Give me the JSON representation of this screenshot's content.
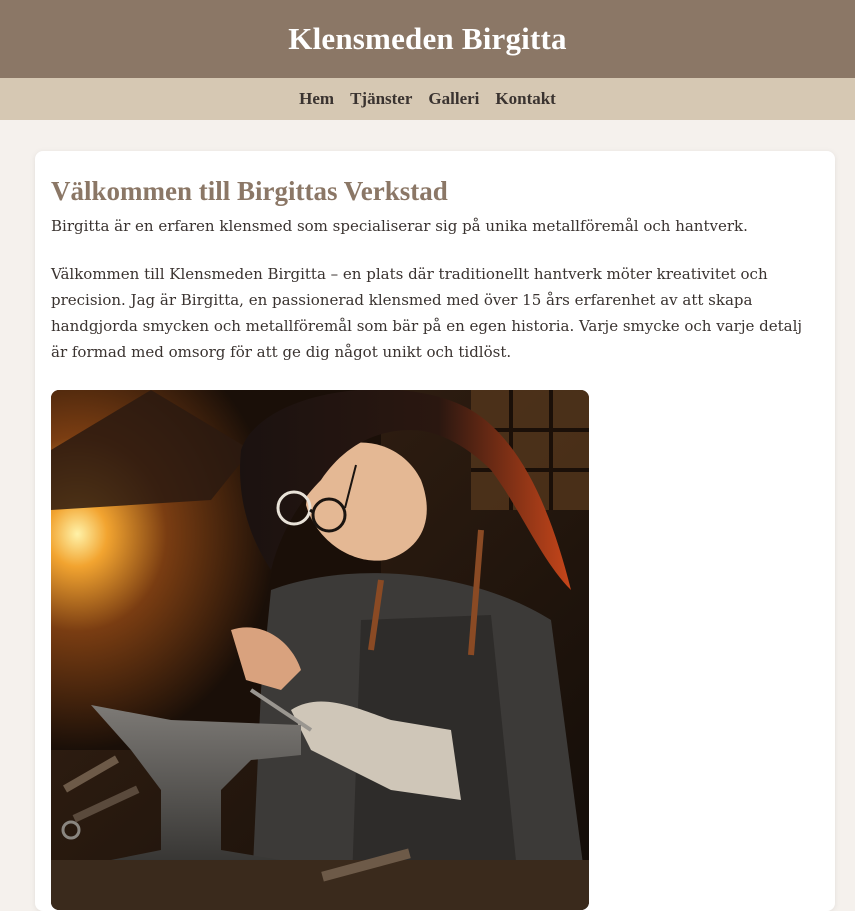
{
  "header": {
    "site_title": "Klensmeden Birgitta"
  },
  "nav": {
    "items": [
      {
        "label": "Hem"
      },
      {
        "label": "Tjänster"
      },
      {
        "label": "Galleri"
      },
      {
        "label": "Kontakt"
      }
    ]
  },
  "main": {
    "title": "Välkommen till Birgittas Verkstad",
    "intro": "Birgitta är en erfaren klensmed som specialiserar sig på unika metallföremål och hantverk.",
    "body": "Välkommen till Klensmeden Birgitta – en plats där traditionellt hantverk möter kreativitet och precision. Jag är Birgitta, en passionerad klensmed med över 15 års erfarenhet av att skapa handgjorda smycken och metallföremål som bär på en egen historia. Varje smycke och varje detalj är formad med omsorg för att ge dig något unikt och tidlöst."
  },
  "colors": {
    "header_bg": "#8b7766",
    "nav_bg": "#d6c8b3",
    "page_bg": "#f5f1ed",
    "title_accent": "#8b7766"
  }
}
